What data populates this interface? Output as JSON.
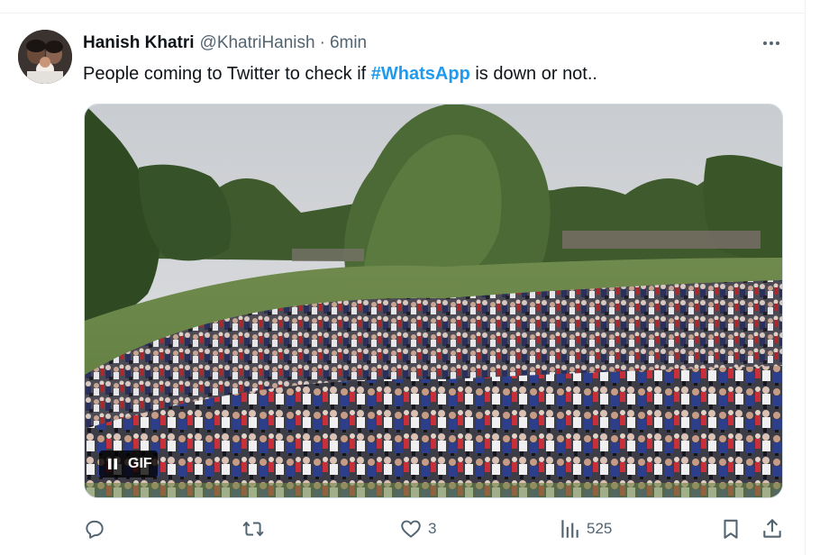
{
  "author": {
    "name": "Hanish Khatri",
    "handle": "@KhatriHanish",
    "separator": "·",
    "time": "6min"
  },
  "tweet": {
    "text_before": "People coming to Twitter to check if ",
    "hashtag": "#WhatsApp",
    "text_after": " is down or not.."
  },
  "media": {
    "badge": "GIF",
    "state": "playing"
  },
  "actions": {
    "reply_count": "",
    "retweet_count": "",
    "like_count": "3",
    "views_count": "525"
  },
  "colors": {
    "link": "#1d9bf0",
    "secondary_text": "#536471",
    "primary_text": "#0f1419"
  },
  "icons": [
    "more-icon",
    "pause-icon",
    "reply-icon",
    "retweet-icon",
    "like-icon",
    "views-icon",
    "bookmark-icon",
    "share-icon"
  ]
}
